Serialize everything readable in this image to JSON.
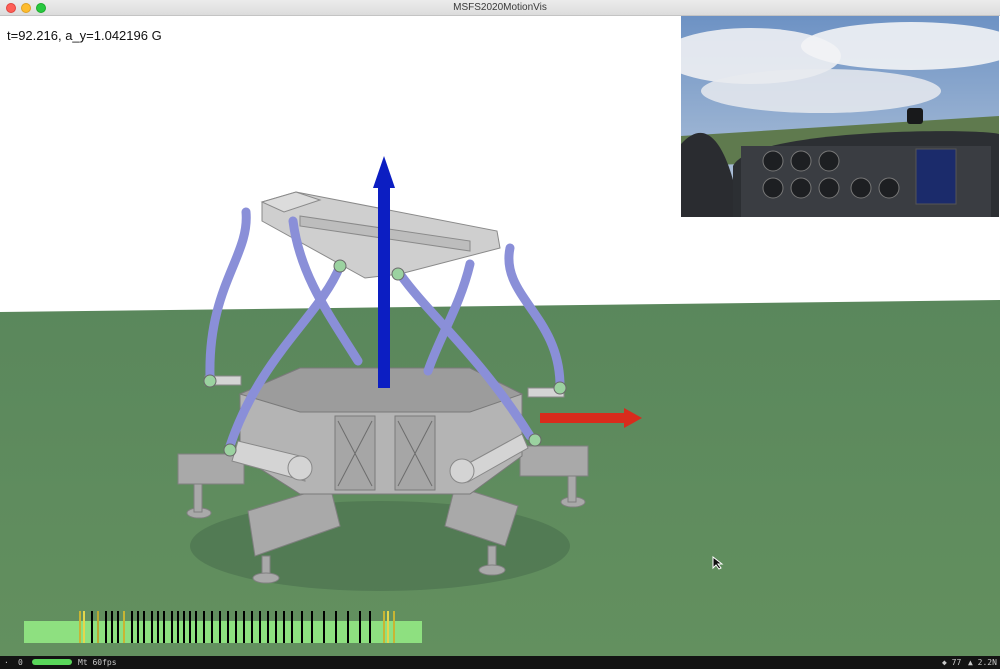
{
  "window": {
    "title": "MSFS2020MotionVis"
  },
  "overlay": {
    "readout": "t=92.216, a_y=1.042196 G"
  },
  "colors": {
    "ground": "#5e8a5f",
    "sky": "#ffffff",
    "axis_up": "#0c1ec2",
    "axis_forward": "#d92b1c",
    "actuator": "#8a8fd8",
    "platform": "#b9b9b9"
  },
  "camera_feed": {
    "instrument_panel": "cockpit-view"
  },
  "statusbar": {
    "left_icon": "·",
    "left_num": "0",
    "fps": "Mt 60fps",
    "r1": "◆ 77",
    "r2": "▲ 2.2N"
  }
}
